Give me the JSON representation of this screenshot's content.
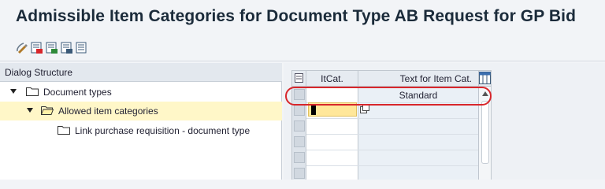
{
  "window": {
    "title": "Admissible Item Categories for Document Type AB Request for GP Bid"
  },
  "toolbar": {
    "icons": [
      "change-display-icon",
      "new-entries-icon",
      "copy-as-icon",
      "delete-icon",
      "undo-change-icon"
    ]
  },
  "dialog_structure": {
    "header": "Dialog Structure",
    "items": [
      {
        "label": "Document types",
        "expanded": true,
        "level": 0
      },
      {
        "label": "Allowed item categories",
        "expanded": true,
        "level": 1,
        "selected": true
      },
      {
        "label": "Link purchase requisition - document type",
        "level": 2
      }
    ]
  },
  "table": {
    "columns": [
      "ItCat.",
      "Text for Item Cat."
    ],
    "rows": [
      {
        "itcat": "",
        "text": "Standard"
      },
      {
        "itcat": "",
        "text": ""
      }
    ]
  },
  "colors": {
    "highlight": "#d8262b",
    "selected_row": "#fff7c8",
    "input_active": "#ffe79a"
  }
}
